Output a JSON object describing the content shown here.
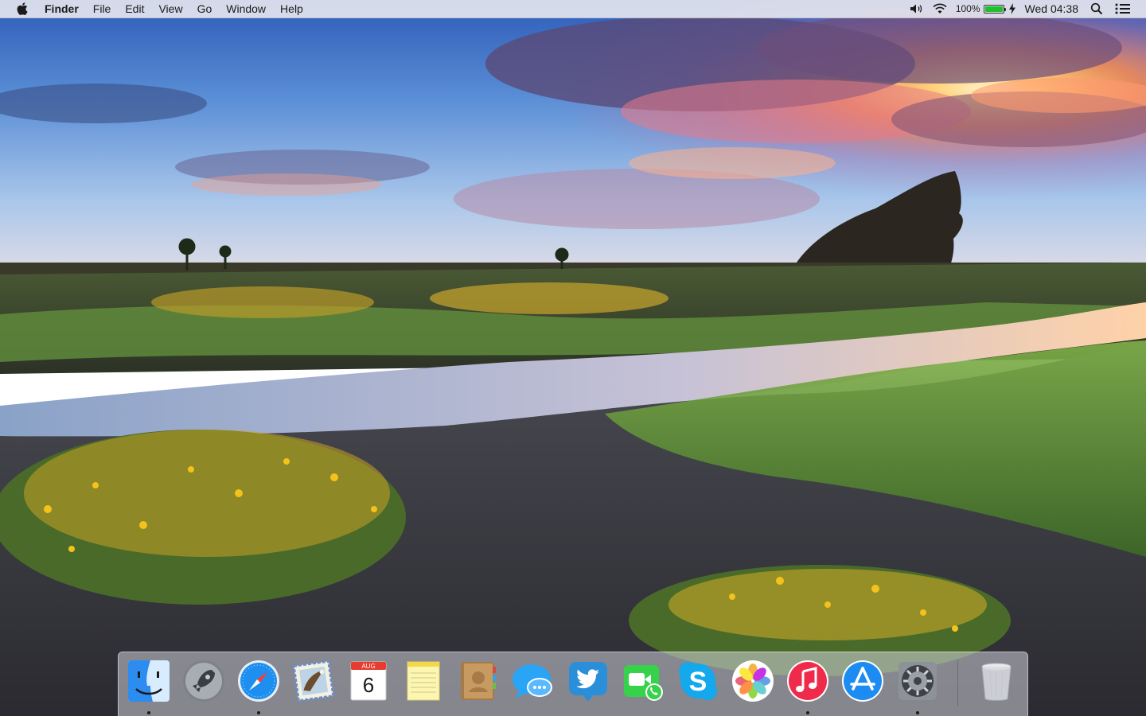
{
  "menubar": {
    "app_name": "Finder",
    "menus": [
      "File",
      "Edit",
      "View",
      "Go",
      "Window",
      "Help"
    ],
    "battery_percent_text": "100%",
    "battery_level": 1.0,
    "clock": "Wed 04:38",
    "icons": [
      "apple-icon",
      "volume-icon",
      "wifi-icon",
      "battery-icon",
      "charging-icon",
      "spotlight-search-icon",
      "notification-center-icon"
    ]
  },
  "dock": {
    "apps": [
      {
        "name": "Finder",
        "icon": "finder-icon",
        "running": true
      },
      {
        "name": "Launchpad",
        "icon": "launchpad-icon",
        "running": false
      },
      {
        "name": "Safari",
        "icon": "safari-icon",
        "running": true
      },
      {
        "name": "Mail",
        "icon": "mail-icon",
        "running": false
      },
      {
        "name": "Calendar",
        "icon": "calendar-icon",
        "running": false
      },
      {
        "name": "Notes",
        "icon": "notes-icon",
        "running": false
      },
      {
        "name": "Contacts",
        "icon": "contacts-icon",
        "running": false
      },
      {
        "name": "Messages",
        "icon": "messages-icon",
        "running": false
      },
      {
        "name": "Twitter",
        "icon": "twitter-icon",
        "running": false
      },
      {
        "name": "FaceTime",
        "icon": "facetime-icon",
        "running": false
      },
      {
        "name": "Skype",
        "icon": "skype-icon",
        "running": false
      },
      {
        "name": "Photos",
        "icon": "photos-icon",
        "running": false
      },
      {
        "name": "iTunes",
        "icon": "itunes-icon",
        "running": true
      },
      {
        "name": "App Store",
        "icon": "app-store-icon",
        "running": false
      },
      {
        "name": "System Preferences",
        "icon": "system-preferences-icon",
        "running": true
      }
    ],
    "calendar": {
      "month": "AUG",
      "day": "6"
    },
    "trash": {
      "name": "Trash",
      "icon": "trash-icon"
    }
  },
  "colors": {
    "menubar_bg": "#ececf0",
    "battery_green": "#1fbf2e",
    "sky_top": "#2f5fb8",
    "sunset_orange": "#ff8a4a"
  }
}
